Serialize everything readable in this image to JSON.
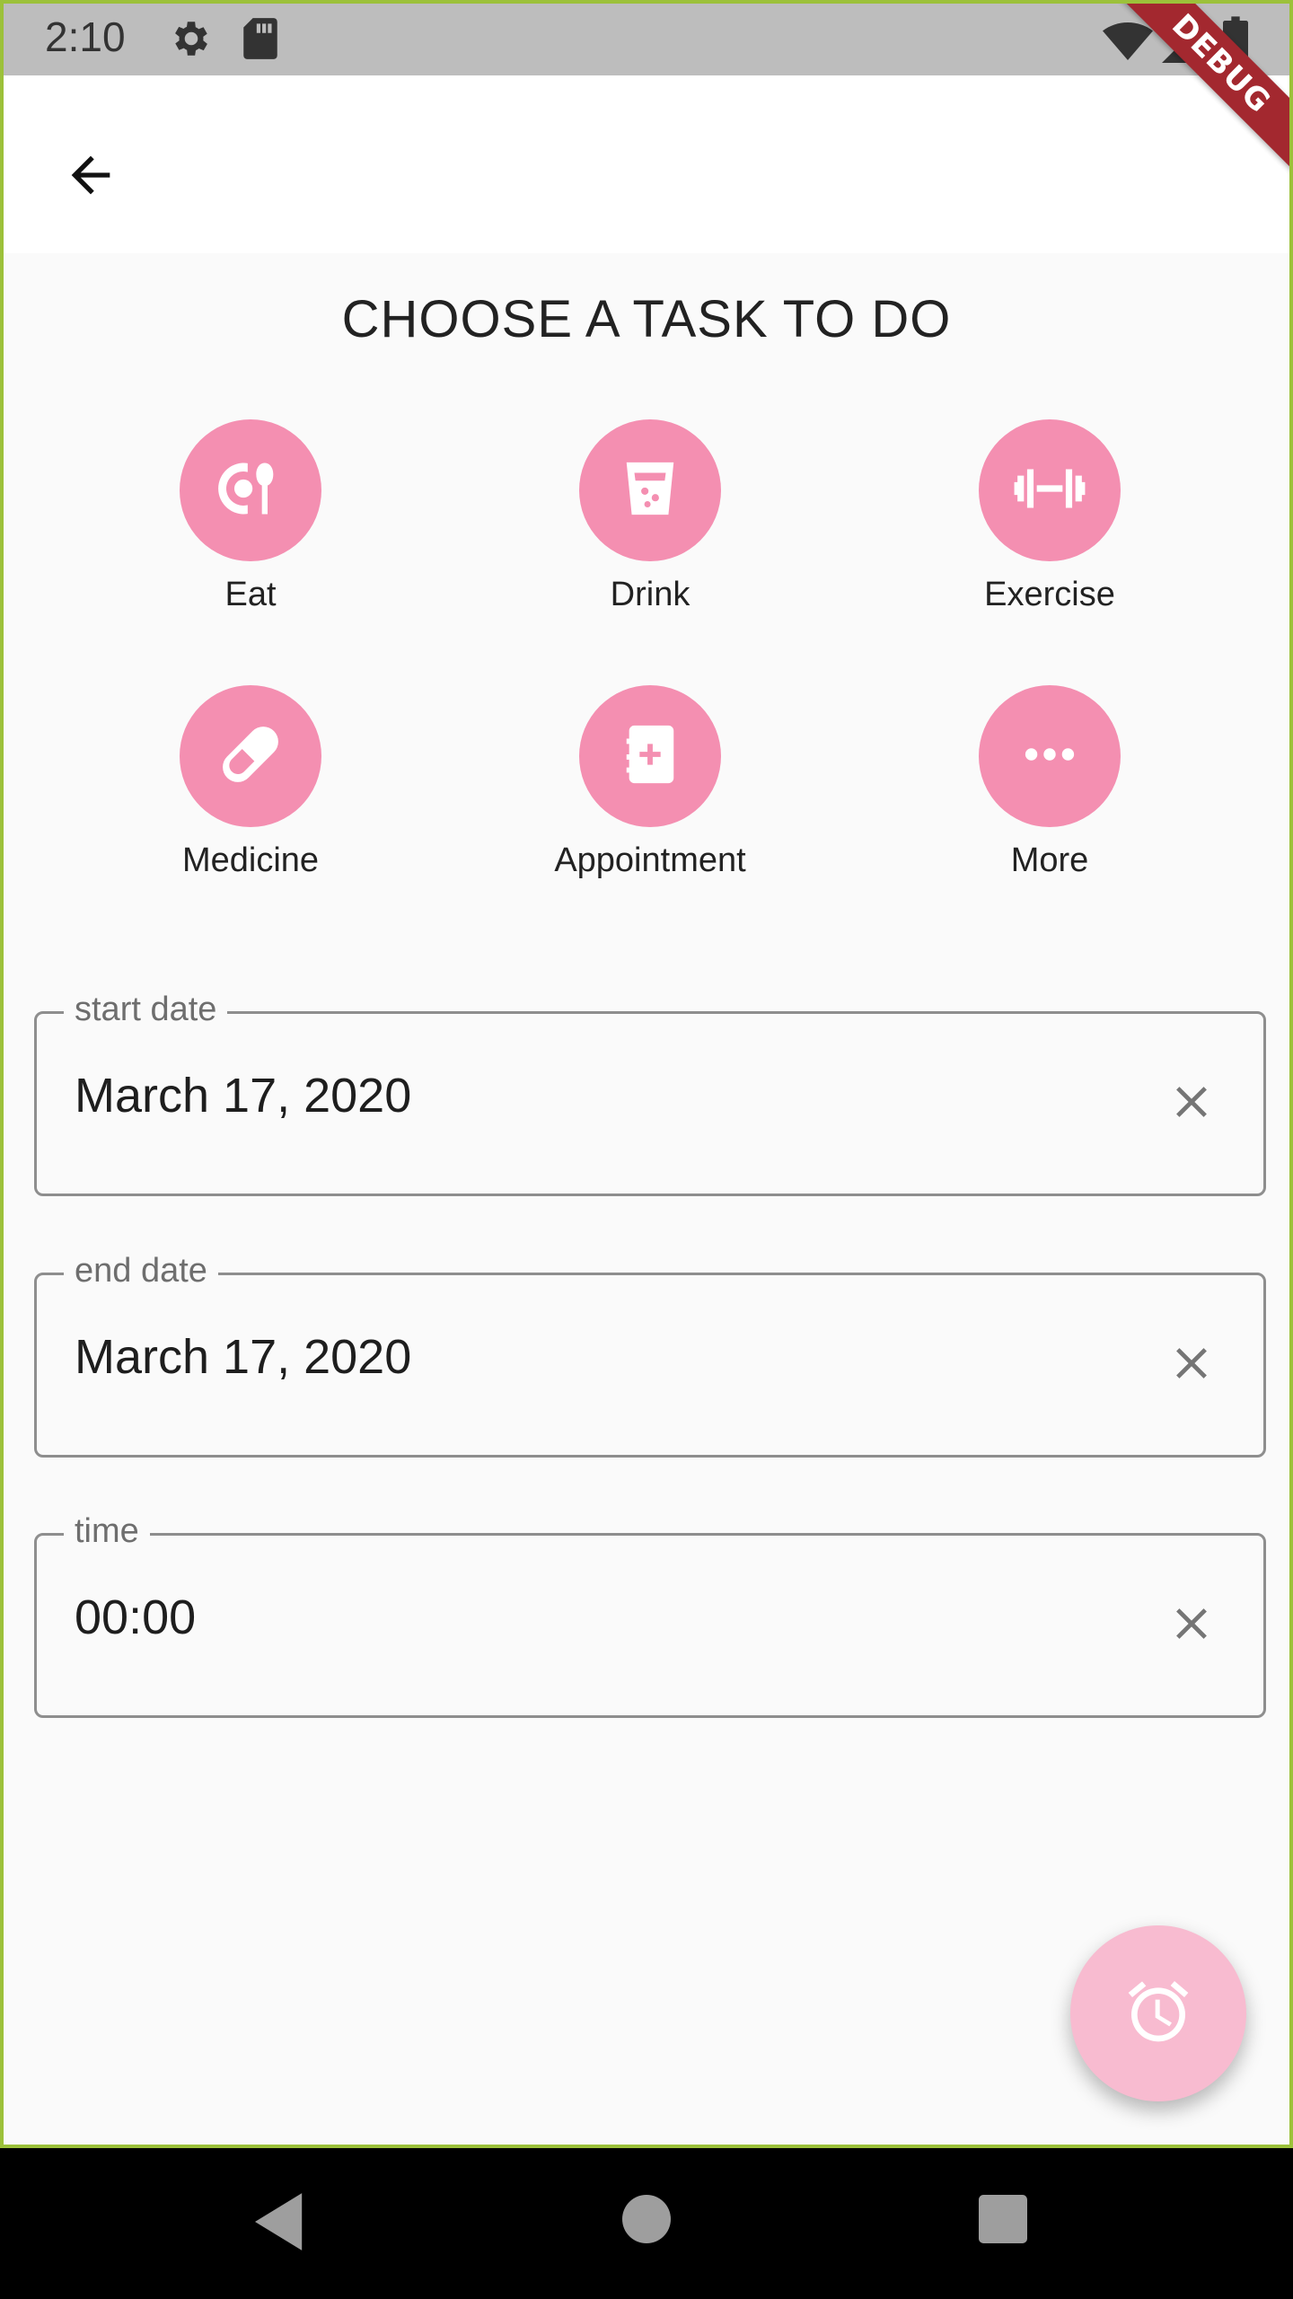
{
  "status_bar": {
    "time": "2:10",
    "icons": [
      "settings-icon",
      "sd-card-icon",
      "wifi-icon",
      "signal-icon",
      "battery-icon"
    ]
  },
  "debug_banner": {
    "label": "DEBUG",
    "color": "#a3282f"
  },
  "app_bar": {
    "back_icon": "arrow-back-icon"
  },
  "heading": "CHOOSE A TASK TO DO",
  "tasks": [
    {
      "label": "Eat",
      "icon": "restaurant-icon"
    },
    {
      "label": "Drink",
      "icon": "glass-icon"
    },
    {
      "label": "Exercise",
      "icon": "dumbbell-icon"
    },
    {
      "label": "Medicine",
      "icon": "pill-icon"
    },
    {
      "label": "Appointment",
      "icon": "medical-book-icon"
    },
    {
      "label": "More",
      "icon": "more-horiz-icon"
    }
  ],
  "fields": {
    "start_date": {
      "label": "start date",
      "value": "March 17, 2020"
    },
    "end_date": {
      "label": "end date",
      "value": "March 17, 2020"
    },
    "time": {
      "label": "time",
      "value": "00:00"
    }
  },
  "fab": {
    "icon": "alarm-icon"
  },
  "nav": [
    "back-nav-icon",
    "home-nav-icon",
    "recents-nav-icon"
  ],
  "colors": {
    "accent": "#f48fb1",
    "fab": "#f8bbd0",
    "frame_border": "#9cc13a",
    "status_bar": "#bdbdbd",
    "background": "#fafafa"
  }
}
